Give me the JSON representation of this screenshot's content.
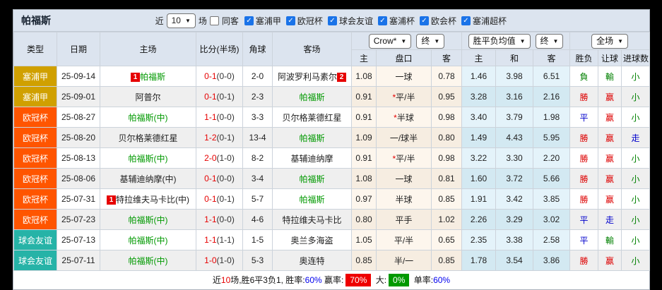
{
  "title": "帕福斯",
  "controls": {
    "near_label": "近",
    "matches_select": "10",
    "matches_label": "场",
    "same_venue": {
      "label": "同客",
      "checked": false
    },
    "leagues": [
      {
        "label": "塞浦甲",
        "checked": true
      },
      {
        "label": "欧冠杯",
        "checked": true
      },
      {
        "label": "球会友谊",
        "checked": true
      },
      {
        "label": "塞浦杯",
        "checked": true
      },
      {
        "label": "欧会杯",
        "checked": true
      },
      {
        "label": "塞浦超杯",
        "checked": true
      }
    ]
  },
  "colors": {
    "league": {
      "塞浦甲": "#d0a000",
      "欧冠杯": "#ff5500",
      "球会友谊": "#26b3a7"
    },
    "team_highlight": "#009900",
    "score_fulltime": "#e60000",
    "win": "#dd0000",
    "draw": "#0000cc",
    "lose": "#008000",
    "checkbox": "#1a73e8"
  },
  "table": {
    "headers": [
      "类型",
      "日期",
      "主场",
      "比分(半场)",
      "角球",
      "客场"
    ],
    "group_selects": [
      "Crow*",
      "终",
      "胜平负均值",
      "终",
      "全场"
    ],
    "sub_headers": [
      "主",
      "盘口",
      "客",
      "主",
      "和",
      "客",
      "胜负",
      "让球",
      "进球数"
    ],
    "rows": [
      {
        "type": "塞浦甲",
        "date": "25-09-14",
        "home": {
          "badge": "1",
          "name": "帕福斯",
          "green": true
        },
        "score": {
          "ft": "0-1",
          "ht": "(0-0)"
        },
        "corner": "2-0",
        "away": {
          "name": "阿波罗利马素尔",
          "green": false,
          "badge_after": "2"
        },
        "asian": {
          "h": "1.08",
          "star": false,
          "line": "一球",
          "a": "0.78"
        },
        "euro": {
          "h": "1.46",
          "d": "3.98",
          "a": "6.51"
        },
        "res": [
          {
            "t": "負",
            "c": "green"
          },
          {
            "t": "輸",
            "c": "green"
          },
          {
            "t": "小",
            "c": "green"
          }
        ]
      },
      {
        "type": "塞浦甲",
        "date": "25-09-01",
        "home": {
          "name": "阿普尔",
          "green": false
        },
        "score": {
          "ft": "0-1",
          "ht": "(0-1)"
        },
        "corner": "2-3",
        "away": {
          "name": "帕福斯",
          "green": true
        },
        "asian": {
          "h": "0.91",
          "star": true,
          "line": "平/半",
          "a": "0.95"
        },
        "euro": {
          "h": "3.28",
          "d": "3.16",
          "a": "2.16"
        },
        "res": [
          {
            "t": "勝",
            "c": "red"
          },
          {
            "t": "赢",
            "c": "red"
          },
          {
            "t": "小",
            "c": "green"
          }
        ]
      },
      {
        "type": "欧冠杯",
        "date": "25-08-27",
        "home": {
          "name": "帕福斯(中)",
          "green": true
        },
        "score": {
          "ft": "1-1",
          "ht": "(0-0)"
        },
        "corner": "3-3",
        "away": {
          "name": "贝尔格莱德红星",
          "green": false
        },
        "asian": {
          "h": "0.91",
          "star": true,
          "line": "半球",
          "a": "0.98"
        },
        "euro": {
          "h": "3.40",
          "d": "3.79",
          "a": "1.98"
        },
        "res": [
          {
            "t": "平",
            "c": "blue"
          },
          {
            "t": "赢",
            "c": "red"
          },
          {
            "t": "小",
            "c": "green"
          }
        ]
      },
      {
        "type": "欧冠杯",
        "date": "25-08-20",
        "home": {
          "name": "贝尔格莱德红星",
          "green": false
        },
        "score": {
          "ft": "1-2",
          "ht": "(0-1)"
        },
        "corner": "13-4",
        "away": {
          "name": "帕福斯",
          "green": true
        },
        "asian": {
          "h": "1.09",
          "star": false,
          "line": "一/球半",
          "a": "0.80"
        },
        "euro": {
          "h": "1.49",
          "d": "4.43",
          "a": "5.95"
        },
        "res": [
          {
            "t": "勝",
            "c": "red"
          },
          {
            "t": "赢",
            "c": "red"
          },
          {
            "t": "走",
            "c": "blue"
          }
        ]
      },
      {
        "type": "欧冠杯",
        "date": "25-08-13",
        "home": {
          "name": "帕福斯(中)",
          "green": true
        },
        "score": {
          "ft": "2-0",
          "ht": "(1-0)"
        },
        "corner": "8-2",
        "away": {
          "name": "基辅迪纳摩",
          "green": false
        },
        "asian": {
          "h": "0.91",
          "star": true,
          "line": "平/半",
          "a": "0.98"
        },
        "euro": {
          "h": "3.22",
          "d": "3.30",
          "a": "2.20"
        },
        "res": [
          {
            "t": "勝",
            "c": "red"
          },
          {
            "t": "赢",
            "c": "red"
          },
          {
            "t": "小",
            "c": "green"
          }
        ]
      },
      {
        "type": "欧冠杯",
        "date": "25-08-06",
        "home": {
          "name": "基辅迪纳摩(中)",
          "green": false
        },
        "score": {
          "ft": "0-1",
          "ht": "(0-0)"
        },
        "corner": "3-4",
        "away": {
          "name": "帕福斯",
          "green": true
        },
        "asian": {
          "h": "1.08",
          "star": false,
          "line": "一球",
          "a": "0.81"
        },
        "euro": {
          "h": "1.60",
          "d": "3.72",
          "a": "5.66"
        },
        "res": [
          {
            "t": "勝",
            "c": "red"
          },
          {
            "t": "赢",
            "c": "red"
          },
          {
            "t": "小",
            "c": "green"
          }
        ]
      },
      {
        "type": "欧冠杯",
        "date": "25-07-31",
        "home": {
          "badge": "1",
          "name": "特拉维夫马卡比(中)",
          "green": false
        },
        "score": {
          "ft": "0-1",
          "ht": "(0-1)"
        },
        "corner": "5-7",
        "away": {
          "name": "帕福斯",
          "green": true
        },
        "asian": {
          "h": "0.97",
          "star": false,
          "line": "半球",
          "a": "0.85"
        },
        "euro": {
          "h": "1.91",
          "d": "3.42",
          "a": "3.85"
        },
        "res": [
          {
            "t": "勝",
            "c": "red"
          },
          {
            "t": "赢",
            "c": "red"
          },
          {
            "t": "小",
            "c": "green"
          }
        ]
      },
      {
        "type": "欧冠杯",
        "date": "25-07-23",
        "home": {
          "name": "帕福斯(中)",
          "green": true
        },
        "score": {
          "ft": "1-1",
          "ht": "(0-0)"
        },
        "corner": "4-6",
        "away": {
          "name": "特拉维夫马卡比",
          "green": false
        },
        "asian": {
          "h": "0.80",
          "star": false,
          "line": "平手",
          "a": "1.02"
        },
        "euro": {
          "h": "2.26",
          "d": "3.29",
          "a": "3.02"
        },
        "res": [
          {
            "t": "平",
            "c": "blue"
          },
          {
            "t": "走",
            "c": "blue"
          },
          {
            "t": "小",
            "c": "green"
          }
        ]
      },
      {
        "type": "球会友谊",
        "date": "25-07-13",
        "home": {
          "name": "帕福斯(中)",
          "green": true
        },
        "score": {
          "ft": "1-1",
          "ht": "(1-1)"
        },
        "corner": "1-5",
        "away": {
          "name": "奥兰多海盗",
          "green": false
        },
        "asian": {
          "h": "1.05",
          "star": false,
          "line": "平/半",
          "a": "0.65"
        },
        "euro": {
          "h": "2.35",
          "d": "3.38",
          "a": "2.58"
        },
        "res": [
          {
            "t": "平",
            "c": "blue"
          },
          {
            "t": "輸",
            "c": "green"
          },
          {
            "t": "小",
            "c": "green"
          }
        ]
      },
      {
        "type": "球会友谊",
        "date": "25-07-11",
        "home": {
          "name": "帕福斯(中)",
          "green": true
        },
        "score": {
          "ft": "1-0",
          "ht": "(1-0)"
        },
        "corner": "5-3",
        "away": {
          "name": "奥连特",
          "green": false
        },
        "asian": {
          "h": "0.85",
          "star": false,
          "line": "半/一",
          "a": "0.85"
        },
        "euro": {
          "h": "1.78",
          "d": "3.54",
          "a": "3.86"
        },
        "res": [
          {
            "t": "勝",
            "c": "red"
          },
          {
            "t": "赢",
            "c": "red"
          },
          {
            "t": "小",
            "c": "green"
          }
        ]
      }
    ]
  },
  "footer": {
    "segments": [
      {
        "text": "近",
        "style": "plain"
      },
      {
        "text": "10",
        "style": "red-text"
      },
      {
        "text": "场,胜6平3负1, 胜率:",
        "style": "plain"
      },
      {
        "text": "60%",
        "style": "blue-text"
      },
      {
        "text": " 赢率:",
        "style": "plain"
      },
      {
        "text": "70%",
        "style": "red-badge"
      },
      {
        "text": " 大:",
        "style": "plain"
      },
      {
        "text": "0%",
        "style": "green-badge"
      },
      {
        "text": " 单率:",
        "style": "plain"
      },
      {
        "text": "60%",
        "style": "blue-text"
      }
    ]
  }
}
